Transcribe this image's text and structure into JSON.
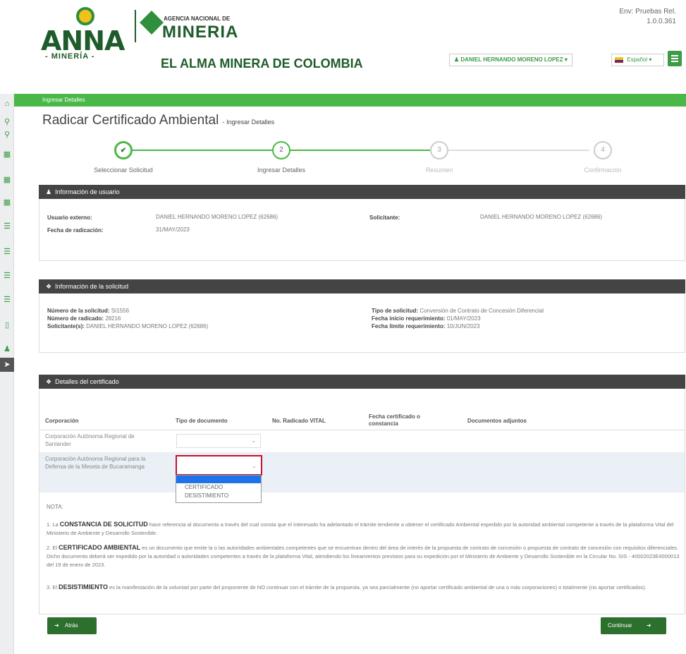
{
  "header": {
    "env_line1": "Env: Pruebas Rel.",
    "env_line2": "1.0.0.361",
    "logo_anna": "ANNA",
    "logo_anna_sub": "- MINERÍA -",
    "agencia_top": "AGENCIA NACIONAL DE",
    "agencia_main": "MINERIA",
    "slogan": "EL ALMA MINERA DE COLOMBIA",
    "user_menu": "DANIEL HERNANDO MORENO LOPEZ",
    "language": "Español"
  },
  "breadcrumb": "Ingresar Detalles",
  "page": {
    "title": "Radicar Certificado Ambiental",
    "subtitle": "- Ingresar Detalles"
  },
  "stepper": [
    {
      "number": "✔",
      "label": "Seleccionar Solicitud",
      "state": "done"
    },
    {
      "number": "2",
      "label": "Ingresar Detalles",
      "state": "active"
    },
    {
      "number": "3",
      "label": "Resumen",
      "state": "pending"
    },
    {
      "number": "4",
      "label": "Confirmación",
      "state": "pending"
    }
  ],
  "user_info": {
    "heading": "Información de usuario",
    "external_user_label": "Usuario externo:",
    "external_user_value": "DANIEL HERNANDO MORENO LOPEZ (62686)",
    "applicant_label": "Solicitante:",
    "applicant_value": "DANIEL HERNANDO MORENO LOPEZ (62686)",
    "date_label": "Fecha de radicación:",
    "date_value": "31/MAY/2023"
  },
  "request_info": {
    "heading": "Información de la solicitud",
    "number_label": "Número de la solicitud:",
    "number_value": "SI1556",
    "filed_label": "Número de radicado:",
    "filed_value": "28216",
    "applicants_label": "Solicitante(s):",
    "applicants_value": "DANIEL HERNANDO MORENO LOPEZ (62686)",
    "type_label": "Tipo de solicitud:",
    "type_value": "Conversión de Contrato de Concesión Diferencial",
    "start_label": "Fecha inicio requerimiento:",
    "start_value": "01/MAY/2023",
    "end_label": "Fecha límite requerimiento:",
    "end_value": "10/JUN/2023"
  },
  "cert_details": {
    "heading": "Detalles del certificado",
    "columns": [
      "Corporación",
      "Tipo de documento",
      "No. Radicado VITAL",
      "Fecha certificado o constancia",
      "Documentos adjuntos"
    ],
    "rows": [
      {
        "corporation": "Corporación Autónoma Regional de Santander"
      },
      {
        "corporation": "Corporación Autónoma Regional para la Defensa de la Meseta de Bucaramanga"
      }
    ],
    "dropdown_options": [
      "CERTIFICADO",
      "DESISTIMIENTO"
    ]
  },
  "nota": {
    "title": "NOTA:",
    "p1_prefix": "1. La",
    "p1_term": "CONSTANCIA DE SOLICITUD",
    "p1_text": "hace referencia al documento a través del cual consta que el interesado ha adelantado el trámite tendiente a obtener el certificado Ambiental expedido por la autoridad ambiental competente a través de la plataforma Vital del Ministerio de Ambiente y Desarrollo Sostenible.",
    "p2_prefix": "2. El",
    "p2_term": "CERTIFICADO AMBIENTAL",
    "p2_text": "es un documento que emite la o las autoridades ambientales competentes que se encuentran dentro del área de interés de la propuesta de contrato de concesión o propuesta de contrato de concesión con requisitos diferenciales. Dicho documento deberá ser expedido por la autoridad o autoridades competentes a través de la plataforma Vital, atendiendo los lineamientos previstos para su expedición por el Ministerio de Ambiente y Desarrollo Sostenible en la Circular No. SIS - 40002023E4000013 del 19 de enero de 2023.",
    "p3_prefix": "3. El",
    "p3_term": "DESISTIMIENTO",
    "p3_text": "es la manifestación de la voluntad por parte del proponente de NO continuar con el trámite de la propuesta, ya sea parcialmente (no aportar certificado ambiental de una o más corporaciones) o totalmente (no aportar certificados)."
  },
  "buttons": {
    "back": "Atrás",
    "next": "Continuar"
  },
  "colors": {
    "brand_green": "#4ab848",
    "dark_green": "#2d6f2c",
    "panel_dark": "#444444"
  }
}
